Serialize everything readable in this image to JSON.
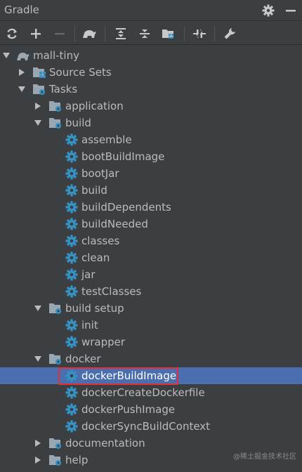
{
  "window": {
    "title": "Gradle"
  },
  "tree": {
    "root": "mall-tiny",
    "source_sets": "Source Sets",
    "tasks": "Tasks",
    "groups": {
      "application": "application",
      "build": "build",
      "build_setup": "build setup",
      "docker": "docker",
      "documentation": "documentation",
      "help": "help"
    },
    "build_tasks": [
      "assemble",
      "bootBuildImage",
      "bootJar",
      "build",
      "buildDependents",
      "buildNeeded",
      "classes",
      "clean",
      "jar",
      "testClasses"
    ],
    "build_setup_tasks": [
      "init",
      "wrapper"
    ],
    "docker_tasks": [
      "dockerBuildImage",
      "dockerCreateDockerfile",
      "dockerPushImage",
      "dockerSyncBuildContext"
    ],
    "selected": "dockerBuildImage"
  },
  "watermark": "@稀土掘金技术社区",
  "colors": {
    "background": "#3c3f41",
    "selection": "#4b6eaf",
    "gear": "#3592c4",
    "highlight_border": "#e0303a"
  }
}
